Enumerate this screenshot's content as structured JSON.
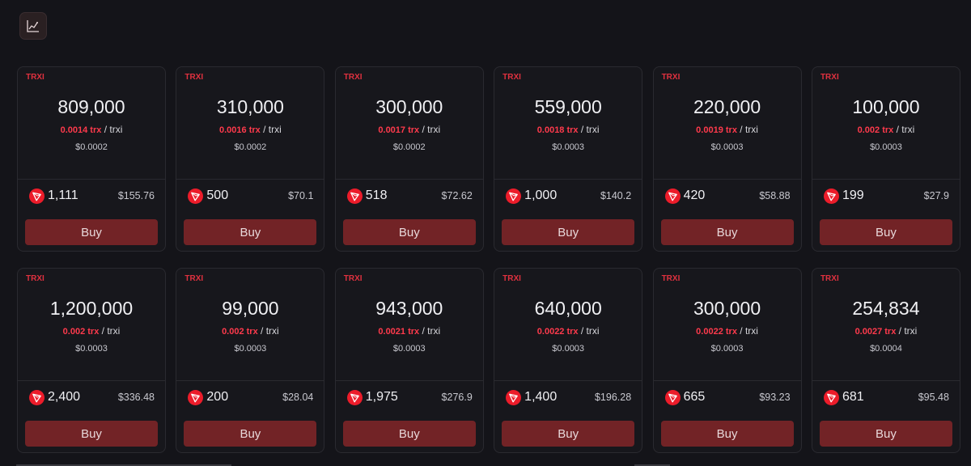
{
  "toolbar": {
    "chart_icon": "line-chart-icon"
  },
  "colors": {
    "background": "#141419",
    "accent_red": "#e0313f",
    "buy_button": "#722326",
    "tron_red": "#ec1c2a"
  },
  "listings": [
    {
      "ticker": "TRXI",
      "amount": "809,000",
      "price_trx": "0.0014 trx",
      "price_sep": " / trxi",
      "price_usd": "$0.0002",
      "total_trx": "1,111",
      "total_usd": "$155.76",
      "buy_label": "Buy"
    },
    {
      "ticker": "TRXI",
      "amount": "310,000",
      "price_trx": "0.0016 trx",
      "price_sep": " / trxi",
      "price_usd": "$0.0002",
      "total_trx": "500",
      "total_usd": "$70.1",
      "buy_label": "Buy"
    },
    {
      "ticker": "TRXI",
      "amount": "300,000",
      "price_trx": "0.0017 trx",
      "price_sep": " / trxi",
      "price_usd": "$0.0002",
      "total_trx": "518",
      "total_usd": "$72.62",
      "buy_label": "Buy"
    },
    {
      "ticker": "TRXI",
      "amount": "559,000",
      "price_trx": "0.0018 trx",
      "price_sep": " / trxi",
      "price_usd": "$0.0003",
      "total_trx": "1,000",
      "total_usd": "$140.2",
      "buy_label": "Buy"
    },
    {
      "ticker": "TRXI",
      "amount": "220,000",
      "price_trx": "0.0019 trx",
      "price_sep": " / trxi",
      "price_usd": "$0.0003",
      "total_trx": "420",
      "total_usd": "$58.88",
      "buy_label": "Buy"
    },
    {
      "ticker": "TRXI",
      "amount": "100,000",
      "price_trx": "0.002 trx",
      "price_sep": " / trxi",
      "price_usd": "$0.0003",
      "total_trx": "199",
      "total_usd": "$27.9",
      "buy_label": "Buy"
    },
    {
      "ticker": "TRXI",
      "amount": "1,200,000",
      "price_trx": "0.002 trx",
      "price_sep": " / trxi",
      "price_usd": "$0.0003",
      "total_trx": "2,400",
      "total_usd": "$336.48",
      "buy_label": "Buy"
    },
    {
      "ticker": "TRXI",
      "amount": "99,000",
      "price_trx": "0.002 trx",
      "price_sep": " / trxi",
      "price_usd": "$0.0003",
      "total_trx": "200",
      "total_usd": "$28.04",
      "buy_label": "Buy"
    },
    {
      "ticker": "TRXI",
      "amount": "943,000",
      "price_trx": "0.0021 trx",
      "price_sep": " / trxi",
      "price_usd": "$0.0003",
      "total_trx": "1,975",
      "total_usd": "$276.9",
      "buy_label": "Buy"
    },
    {
      "ticker": "TRXI",
      "amount": "640,000",
      "price_trx": "0.0022 trx",
      "price_sep": " / trxi",
      "price_usd": "$0.0003",
      "total_trx": "1,400",
      "total_usd": "$196.28",
      "buy_label": "Buy"
    },
    {
      "ticker": "TRXI",
      "amount": "300,000",
      "price_trx": "0.0022 trx",
      "price_sep": " / trxi",
      "price_usd": "$0.0003",
      "total_trx": "665",
      "total_usd": "$93.23",
      "buy_label": "Buy"
    },
    {
      "ticker": "TRXI",
      "amount": "254,834",
      "price_trx": "0.0027 trx",
      "price_sep": " / trxi",
      "price_usd": "$0.0004",
      "total_trx": "681",
      "total_usd": "$95.48",
      "buy_label": "Buy"
    }
  ]
}
